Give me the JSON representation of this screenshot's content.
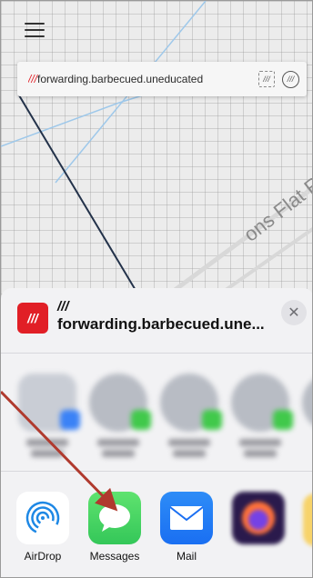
{
  "map": {
    "address_slashes": "///",
    "address_text": "forwarding.barbecued.uneducated",
    "street_label": "ons Flat R",
    "icons": [
      "menu-icon",
      "grid-icon",
      "chat-icon"
    ]
  },
  "share_sheet": {
    "logo_text": "///",
    "header_slashes": "///",
    "header_title": "forwarding.barbecued.une...",
    "close_label": "✕",
    "apps": [
      {
        "label": "AirDrop",
        "icon": "airdrop-icon"
      },
      {
        "label": "Messages",
        "icon": "messages-icon"
      },
      {
        "label": "Mail",
        "icon": "mail-icon"
      },
      {
        "label": "",
        "icon": "firefox-icon"
      }
    ]
  },
  "colors": {
    "brand_red": "#e11f26",
    "messages_green": "#34c759",
    "mail_blue": "#1a6ff2",
    "annotation_arrow": "#b03a2e"
  }
}
